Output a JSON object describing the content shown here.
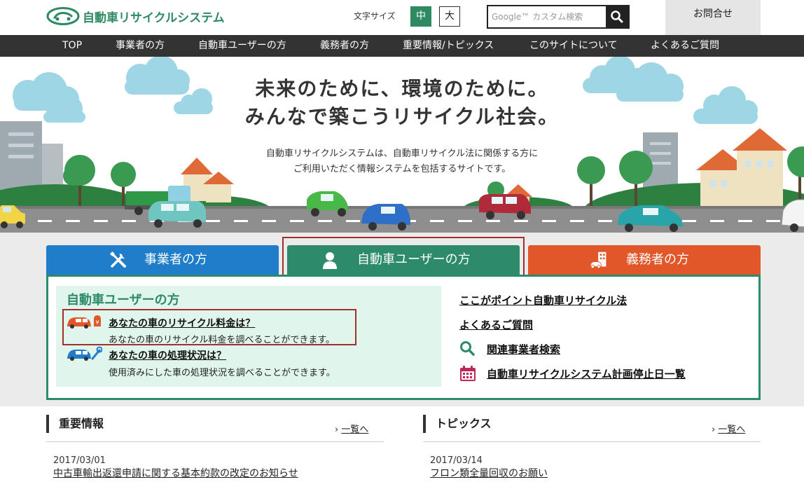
{
  "header": {
    "logo_text": "自動車リサイクルシステム",
    "font_size_label": "文字サイズ",
    "font_size_mid": "中",
    "font_size_large": "大",
    "search_placeholder": "Google™ カスタム検索",
    "search_icon": "search-icon",
    "contact": "お問合せ"
  },
  "nav": {
    "items": [
      "TOP",
      "事業者の方",
      "自動車ユーザーの方",
      "義務者の方",
      "重要情報/トピックス",
      "このサイトについて",
      "よくあるご質問"
    ]
  },
  "hero": {
    "title_line1": "未来のために、環境のために。",
    "title_line2": "みんなで築こうリサイクル社会。",
    "desc_line1": "自動車リサイクルシステムは、自動車リサイクル法に関係する方に",
    "desc_line2": "ご利用いただく情報システムを包括するサイトです。"
  },
  "tabs": [
    {
      "label": "事業者の方",
      "icon": "tools-icon",
      "color": "#1f7dc9"
    },
    {
      "label": "自動車ユーザーの方",
      "icon": "person-icon",
      "color": "#2d8a6a"
    },
    {
      "label": "義務者の方",
      "icon": "building-car-icon",
      "color": "#e2572a"
    }
  ],
  "panel": {
    "heading": "自動車ユーザーの方",
    "items": [
      {
        "title": "あなたの車のリサイクル料金は？",
        "desc": "あなたの車のリサイクル料金を調べることができます。",
        "icon": "car-fee-icon"
      },
      {
        "title": "あなたの車の処理状況は？",
        "desc": "使用済みにした車の処理状況を調べることができます。",
        "icon": "car-repair-icon"
      }
    ],
    "right_links": [
      {
        "label": "ここがポイント自動車リサイクル法"
      },
      {
        "label": "よくあるご質問"
      },
      {
        "label": "関連事業者検索",
        "icon": "search-icon"
      },
      {
        "label": "自動車リサイクルシステム計画停止日一覧",
        "icon": "calendar-icon"
      }
    ]
  },
  "news": {
    "important": {
      "heading": "重要情報",
      "more": "一覧へ",
      "date": "2017/03/01",
      "title": "中古車輸出返還申請に関する基本約款の改定のお知らせ"
    },
    "topics": {
      "heading": "トピックス",
      "more": "一覧へ",
      "date": "2017/03/14",
      "title": "フロン類全量回収のお願い"
    }
  },
  "colors": {
    "brand_green": "#2d8a63",
    "nav_bg": "#333333",
    "business_blue": "#1f7dc9",
    "user_green": "#2d8a6a",
    "duty_orange": "#e2572a",
    "highlight_red": "#a03030"
  }
}
